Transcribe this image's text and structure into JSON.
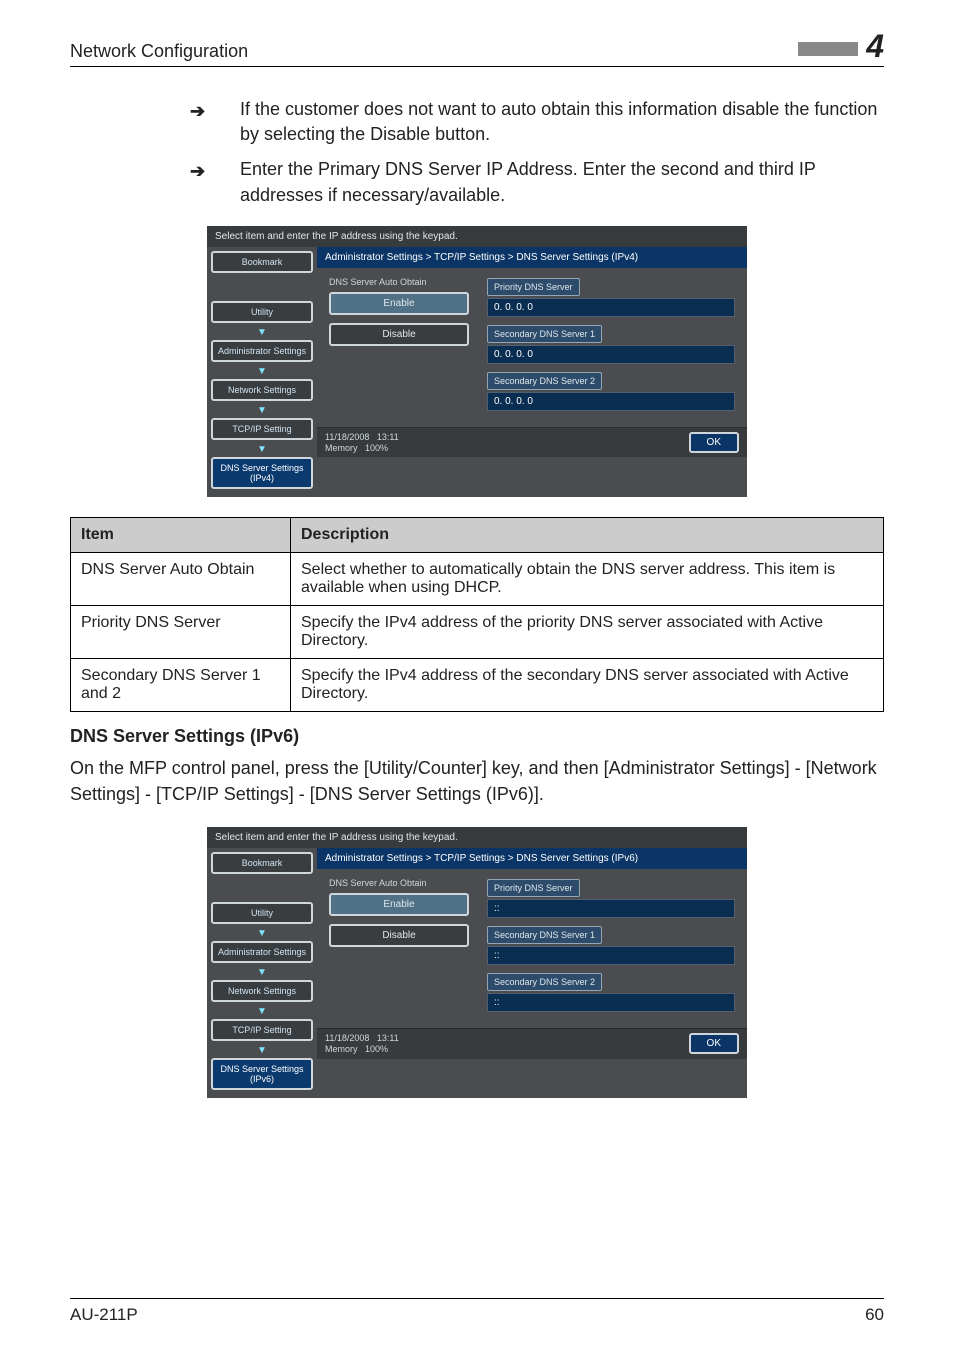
{
  "header": {
    "section_title": "Network Configuration",
    "chapter_num": "4"
  },
  "bullets": [
    "If the customer does not want to auto obtain this information disable the function by selecting the Disable button.",
    "Enter the Primary DNS Server IP Address. Enter the second and third IP addresses if necessary/available."
  ],
  "panel_ipv4": {
    "topbar": "Select item and enter the IP address using the keypad.",
    "sidebar": {
      "bookmark": "Bookmark",
      "utility": "Utility",
      "admin": "Administrator Settings",
      "network": "Network Settings",
      "tcpip": "TCP/IP Setting",
      "active": "DNS Server Settings (IPv4)"
    },
    "breadcrumb": "Administrator Settings > TCP/IP Settings > DNS Server Settings (IPv4)",
    "auto_label": "DNS Server Auto Obtain",
    "enable": "Enable",
    "disable": "Disable",
    "fields": {
      "prio_label": "Priority DNS Server",
      "prio_val": "0. 0. 0. 0",
      "sec1_label": "Secondary DNS Server 1",
      "sec1_val": "0. 0. 0. 0",
      "sec2_label": "Secondary DNS Server 2",
      "sec2_val": "0. 0. 0. 0"
    },
    "foot": {
      "date": "11/18/2008",
      "time": "13:11",
      "mem_label": "Memory",
      "mem_val": "100%",
      "ok": "OK"
    }
  },
  "table": {
    "h_item": "Item",
    "h_desc": "Description",
    "rows": [
      {
        "item": "DNS Server Auto Obtain",
        "desc": "Select whether to automatically obtain the DNS server address. This item is available when using DHCP."
      },
      {
        "item": "Priority DNS Server",
        "desc": "Specify the IPv4 address of the priority DNS server associated with Active Directory."
      },
      {
        "item": "Secondary DNS Server 1 and 2",
        "desc": "Specify the IPv4 address of the secondary DNS server associated with Active Directory."
      }
    ]
  },
  "sub_heading": "DNS Server Settings (IPv6)",
  "sub_para": "On the MFP control panel, press the [Utility/Counter] key, and then [Administrator Settings] - [Network Settings] - [TCP/IP Settings] - [DNS Server Settings (IPv6)].",
  "panel_ipv6": {
    "topbar": "Select item and enter the IP address using the keypad.",
    "sidebar": {
      "bookmark": "Bookmark",
      "utility": "Utility",
      "admin": "Administrator Settings",
      "network": "Network Settings",
      "tcpip": "TCP/IP Setting",
      "active": "DNS Server Settings (IPv6)"
    },
    "breadcrumb": "Administrator Settings > TCP/IP Settings > DNS Server Settings (IPv6)",
    "auto_label": "DNS Server Auto Obtain",
    "enable": "Enable",
    "disable": "Disable",
    "fields": {
      "prio_label": "Priority DNS Server",
      "prio_val": "::",
      "sec1_label": "Secondary DNS Server 1",
      "sec1_val": "::",
      "sec2_label": "Secondary DNS Server 2",
      "sec2_val": "::"
    },
    "foot": {
      "date": "11/18/2008",
      "time": "13:11",
      "mem_label": "Memory",
      "mem_val": "100%",
      "ok": "OK"
    }
  },
  "footer": {
    "left": "AU-211P",
    "right": "60"
  }
}
